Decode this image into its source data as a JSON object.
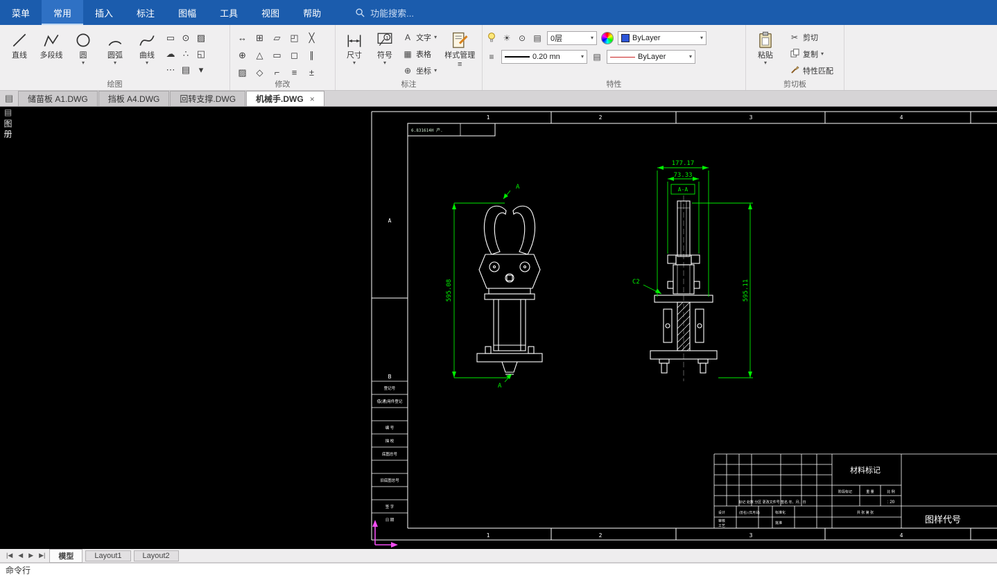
{
  "colors": {
    "menubar": "#1b5cad",
    "dim_green": "#00ee00",
    "ucs_magenta": "#f24df2",
    "line_white": "#ffffff"
  },
  "menu": {
    "items": [
      "菜单",
      "常用",
      "插入",
      "标注",
      "图幅",
      "工具",
      "视图",
      "帮助"
    ],
    "active": "常用",
    "search": "功能搜索..."
  },
  "icons": {
    "dropdown": "▾",
    "draw_minis": [
      "▭",
      "⊙",
      "▨",
      "☁",
      "∴",
      "◱",
      "⋯",
      "▤"
    ],
    "modify_grid": [
      "↔",
      "⊞",
      "▱",
      "◰",
      "╳",
      "⊕",
      "△",
      "▭",
      "◻",
      "∥",
      "▨",
      "◇",
      "⌐",
      "≡",
      "±"
    ],
    "text_icon": "A",
    "table_icon": "▦",
    "coord_icon": "⊕",
    "menu_lines": "≡",
    "sun": "☀",
    "target": "⊙",
    "layers": "▤",
    "cut": "✂"
  },
  "ribbon": {
    "draw": {
      "label": "绘图",
      "line": "直线",
      "polyline": "多段线",
      "circle": "圆",
      "arc": "圆弧",
      "spline": "曲线"
    },
    "modify": {
      "label": "修改"
    },
    "annotate": {
      "label": "标注",
      "dimension": "尺寸",
      "symbol": "符号",
      "text": "文字",
      "table": "表格",
      "coordinate": "坐标",
      "style_manager": "样式管理"
    },
    "properties": {
      "label": "特性",
      "layer": "0层",
      "color": "ByLayer",
      "lineweight": "0.20 mn",
      "linetype": "ByLayer"
    },
    "clipboard": {
      "label": "剪切板",
      "paste": "粘贴",
      "cut": "剪切",
      "copy": "复制",
      "match": "特性匹配"
    }
  },
  "doc_tabs": {
    "tabs": [
      "储苗板 A1.DWG",
      "挡板 A4.DWG",
      "回转支撑.DWG",
      "机械手.DWG"
    ],
    "active": "机械手.DWG",
    "close": "×"
  },
  "palette": {
    "title": "图册"
  },
  "drawing": {
    "zones_top": [
      "1",
      "2",
      "3",
      "4"
    ],
    "zones_bottom": [
      "1",
      "2",
      "3",
      "4"
    ],
    "zone_letters": [
      "A",
      "B"
    ],
    "rev_note": "6.831614H 产.",
    "dims": {
      "left_height": "595.08",
      "top_width": "177.17",
      "inner_width": "73.33",
      "right_height": "595.11",
      "section": "A-A",
      "section_mark": "A",
      "chamfer": "C2"
    },
    "side_rows": [
      "登记号",
      "借(通)用件登记",
      "",
      "编 号",
      "描 校",
      "底图总号",
      "",
      "旧底图总号",
      "",
      "签 字",
      "日 期"
    ],
    "title_block": {
      "material": "材料标记",
      "code": "图样代号",
      "stage": "阶段标记",
      "weight": "重 量",
      "scale": "比 例",
      "scale_value": ": 20",
      "sheets": "共  张  第  张",
      "rev_header": "标记 处数 分区 更改文件号 签名 年、月、日",
      "design": "设计",
      "standard": "标准化",
      "audit": "审核",
      "craft": "工艺",
      "approve": "批准",
      "sign_date": "(签名) (年月日)"
    }
  },
  "layout_bar": {
    "nav": [
      "|◀",
      "◀",
      "▶",
      "▶|"
    ],
    "tabs": [
      "模型",
      "Layout1",
      "Layout2"
    ],
    "active": "模型"
  },
  "command_line": {
    "text": "命令行"
  }
}
